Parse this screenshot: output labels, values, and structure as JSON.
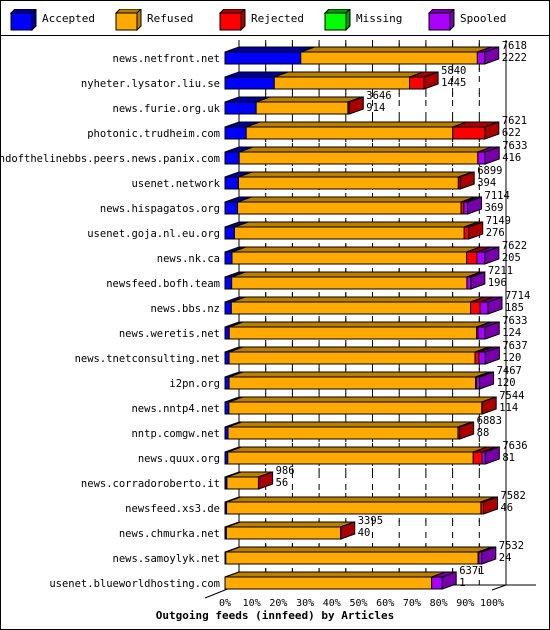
{
  "chart_data": {
    "type": "bar",
    "orientation": "horizontal",
    "stacked": true,
    "style": "3d",
    "title": "Outgoing feeds (innfeed) by Articles",
    "xlabel": "",
    "ylabel": "",
    "xlim": [
      0,
      100
    ],
    "x_unit": "%",
    "x_ticks": [
      "0%",
      "10%",
      "20%",
      "30%",
      "40%",
      "50%",
      "60%",
      "70%",
      "80%",
      "90%",
      "100%"
    ],
    "grid": true,
    "legend_position": "top",
    "legend": [
      {
        "name": "Accepted",
        "color": "#0000ff",
        "side": "#000099"
      },
      {
        "name": "Refused",
        "color": "#ffaa00",
        "side": "#bb7f00"
      },
      {
        "name": "Rejected",
        "color": "#ff0000",
        "side": "#aa0000"
      },
      {
        "name": "Missing",
        "color": "#00ff00",
        "side": "#009900"
      },
      {
        "name": "Spooled",
        "color": "#aa00ff",
        "side": "#7700aa"
      }
    ],
    "categories": [
      "news.netfront.net",
      "nyheter.lysator.liu.se",
      "news.furie.org.uk",
      "photonic.trudheim.com",
      "endofthelinebbs.peers.news.panix.com",
      "usenet.network",
      "news.hispagatos.org",
      "usenet.goja.nl.eu.org",
      "news.nk.ca",
      "newsfeed.bofh.team",
      "news.bbs.nz",
      "news.weretis.net",
      "news.tnetconsulting.net",
      "i2pn.org",
      "news.nntp4.net",
      "nntp.comgw.net",
      "news.quux.org",
      "news.corradoroberto.it",
      "newsfeed.xs3.de",
      "news.chmurka.net",
      "news.samoylyk.net",
      "usenet.blueworldhosting.com"
    ],
    "totals": [
      7618,
      5840,
      3646,
      7621,
      7633,
      6899,
      7114,
      7149,
      7622,
      7211,
      7714,
      7633,
      7637,
      7467,
      7544,
      6883,
      7636,
      986,
      7582,
      3395,
      7532,
      6371
    ],
    "accepted_labels": [
      2222,
      1445,
      914,
      622,
      416,
      394,
      369,
      276,
      205,
      196,
      185,
      124,
      120,
      120,
      114,
      88,
      81,
      56,
      46,
      40,
      24,
      1
    ],
    "series": [
      {
        "name": "Accepted",
        "values": [
          2222,
          1445,
          914,
          622,
          416,
          394,
          369,
          276,
          205,
          196,
          185,
          124,
          120,
          120,
          114,
          88,
          81,
          56,
          46,
          40,
          24,
          1
        ]
      },
      {
        "name": "Refused",
        "values": [
          5180,
          3967,
          2692,
          6059,
          7000,
          6450,
          6555,
          6740,
          6880,
          6900,
          7018,
          7255,
          7215,
          7230,
          7420,
          6745,
          7200,
          925,
          7461,
          3350,
          7400,
          6060
        ]
      },
      {
        "name": "Rejected",
        "values": [
          0,
          428,
          40,
          940,
          0,
          55,
          80,
          133,
          300,
          0,
          280,
          40,
          110,
          25,
          10,
          50,
          255,
          5,
          75,
          5,
          20,
          0
        ]
      },
      {
        "name": "Missing",
        "values": [
          0,
          0,
          0,
          0,
          0,
          0,
          0,
          0,
          0,
          0,
          0,
          0,
          0,
          0,
          0,
          0,
          0,
          0,
          0,
          0,
          0,
          0
        ]
      },
      {
        "name": "Spooled",
        "values": [
          216,
          0,
          0,
          0,
          217,
          0,
          110,
          0,
          237,
          115,
          231,
          214,
          192,
          92,
          0,
          0,
          100,
          0,
          0,
          0,
          88,
          310
        ]
      }
    ],
    "cap_color_rows": [
      "spooled",
      "rejected",
      "rejected",
      "rejected",
      "spooled",
      "rejected",
      "spooled",
      "rejected",
      "spooled",
      "spooled",
      "spooled",
      "spooled",
      "spooled",
      "spooled",
      "rejected",
      "rejected",
      "spooled",
      "rejected",
      "rejected",
      "rejected",
      "spooled",
      "spooled"
    ]
  }
}
